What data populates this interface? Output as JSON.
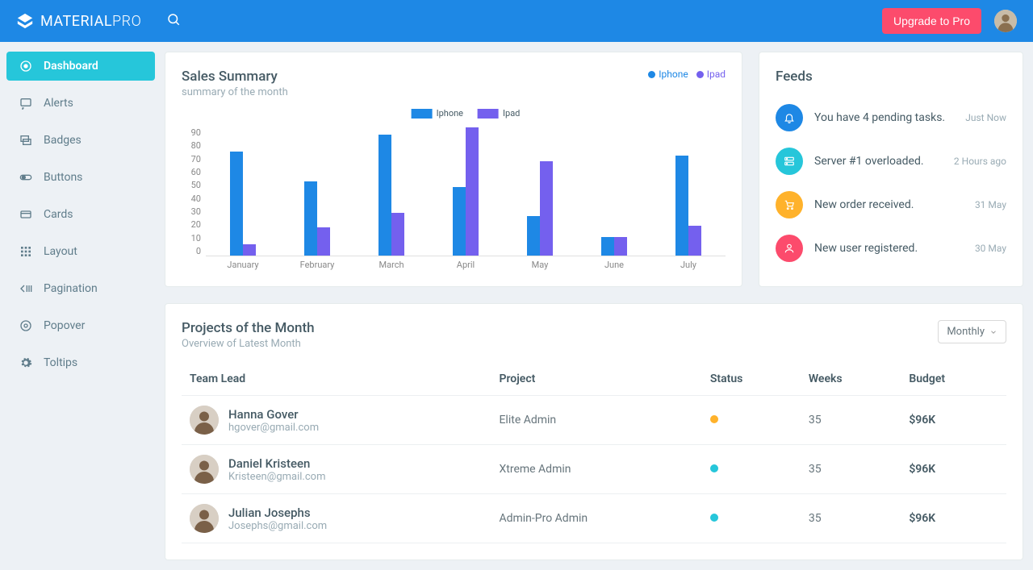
{
  "brand": {
    "name": "MATERIALPRO"
  },
  "header": {
    "upgrade": "Upgrade to Pro"
  },
  "sidebar": {
    "items": [
      {
        "label": "Dashboard",
        "icon": "target-icon",
        "active": true
      },
      {
        "label": "Alerts",
        "icon": "message-icon",
        "active": false
      },
      {
        "label": "Badges",
        "icon": "layers-icon",
        "active": false
      },
      {
        "label": "Buttons",
        "icon": "toggle-icon",
        "active": false
      },
      {
        "label": "Cards",
        "icon": "card-icon",
        "active": false
      },
      {
        "label": "Layout",
        "icon": "grid-icon",
        "active": false
      },
      {
        "label": "Pagination",
        "icon": "pagination-icon",
        "active": false
      },
      {
        "label": "Popover",
        "icon": "disc-icon",
        "active": false
      },
      {
        "label": "Toltips",
        "icon": "gear-icon",
        "active": false
      }
    ]
  },
  "sales": {
    "title": "Sales Summary",
    "subtitle": "summary of the month",
    "legend": [
      {
        "label": "Iphone",
        "color": "#1e88e5"
      },
      {
        "label": "Ipad",
        "color": "#7460ee"
      }
    ]
  },
  "chart_data": {
    "type": "bar",
    "title": "Sales Summary",
    "xlabel": "",
    "ylabel": "",
    "ylim": [
      0,
      90
    ],
    "yticks": [
      0,
      10,
      20,
      30,
      40,
      50,
      60,
      70,
      80,
      90
    ],
    "categories": [
      "January",
      "February",
      "March",
      "April",
      "May",
      "June",
      "July"
    ],
    "series": [
      {
        "name": "Iphone",
        "color": "#1e88e5",
        "values": [
          73,
          52,
          85,
          48,
          28,
          13,
          70
        ]
      },
      {
        "name": "Ipad",
        "color": "#7460ee",
        "values": [
          8,
          20,
          30,
          90,
          66,
          13,
          21
        ]
      }
    ]
  },
  "feeds": {
    "title": "Feeds",
    "items": [
      {
        "text": "You have 4 pending tasks.",
        "time": "Just Now",
        "icon": "bell-icon",
        "color": "#1e88e5"
      },
      {
        "text": "Server #1 overloaded.",
        "time": "2 Hours ago",
        "icon": "server-icon",
        "color": "#26c6da"
      },
      {
        "text": "New order received.",
        "time": "31 May",
        "icon": "cart-icon",
        "color": "#ffb22b"
      },
      {
        "text": "New user registered.",
        "time": "30 May",
        "icon": "user-icon",
        "color": "#fc4b6c"
      }
    ]
  },
  "projects": {
    "title": "Projects of the Month",
    "subtitle": "Overview of Latest Month",
    "filter": "Monthly",
    "columns": {
      "lead": "Team Lead",
      "project": "Project",
      "status": "Status",
      "weeks": "Weeks",
      "budget": "Budget"
    },
    "rows": [
      {
        "name": "Hanna Gover",
        "email": "hgover@gmail.com",
        "project": "Elite Admin",
        "status_color": "#ffb22b",
        "weeks": "35",
        "budget": "$96K"
      },
      {
        "name": "Daniel Kristeen",
        "email": "Kristeen@gmail.com",
        "project": "Xtreme Admin",
        "status_color": "#26c6da",
        "weeks": "35",
        "budget": "$96K"
      },
      {
        "name": "Julian Josephs",
        "email": "Josephs@gmail.com",
        "project": "Admin-Pro Admin",
        "status_color": "#26c6da",
        "weeks": "35",
        "budget": "$96K"
      }
    ]
  }
}
